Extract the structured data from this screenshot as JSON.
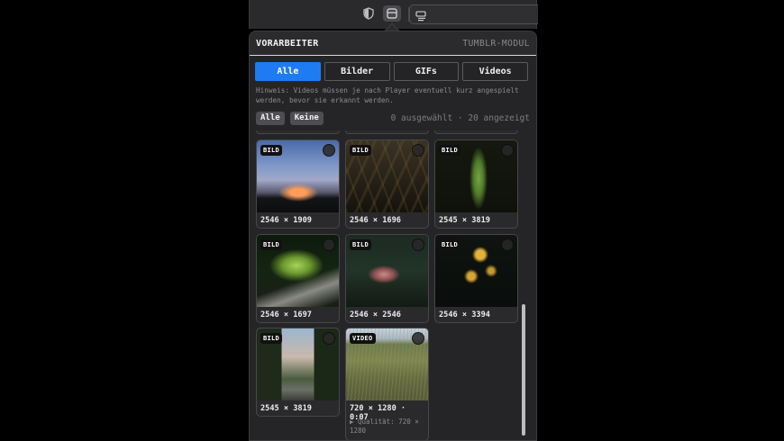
{
  "toolbar": {
    "icons": [
      "shield-icon",
      "panel-icon",
      "reader-icon"
    ]
  },
  "panel": {
    "title": "VORARBEITER",
    "module": "TUMBLR-MODUL"
  },
  "tabs": [
    {
      "label": "Alle",
      "active": true
    },
    {
      "label": "Bilder",
      "active": false
    },
    {
      "label": "GIFs",
      "active": false
    },
    {
      "label": "Videos",
      "active": false
    }
  ],
  "hint": "Hinweis: Videos müssen je nach Player eventuell kurz angespielt werden, bevor sie erkannt werden.",
  "selection": {
    "all_label": "Alle",
    "none_label": "Keine",
    "count_text": "0 ausgewählt · 20 angezeigt"
  },
  "items": [
    {
      "type": "BILD",
      "dims": "2546 × 1909"
    },
    {
      "type": "BILD",
      "dims": "2546 × 1696"
    },
    {
      "type": "BILD",
      "dims": "2545 × 3819"
    },
    {
      "type": "BILD",
      "dims": "2546 × 1697"
    },
    {
      "type": "BILD",
      "dims": "2546 × 2546"
    },
    {
      "type": "BILD",
      "dims": "2546 × 3394"
    },
    {
      "type": "BILD",
      "dims": "2545 × 3819"
    },
    {
      "type": "VIDEO",
      "dims": "720 × 1280 · 0:07",
      "quality": "▶ Qualität: 720 × 1280"
    }
  ],
  "colors": {
    "accent": "#1f7bf2",
    "panel_bg": "#252527",
    "card_bg": "#2a2a2c"
  }
}
